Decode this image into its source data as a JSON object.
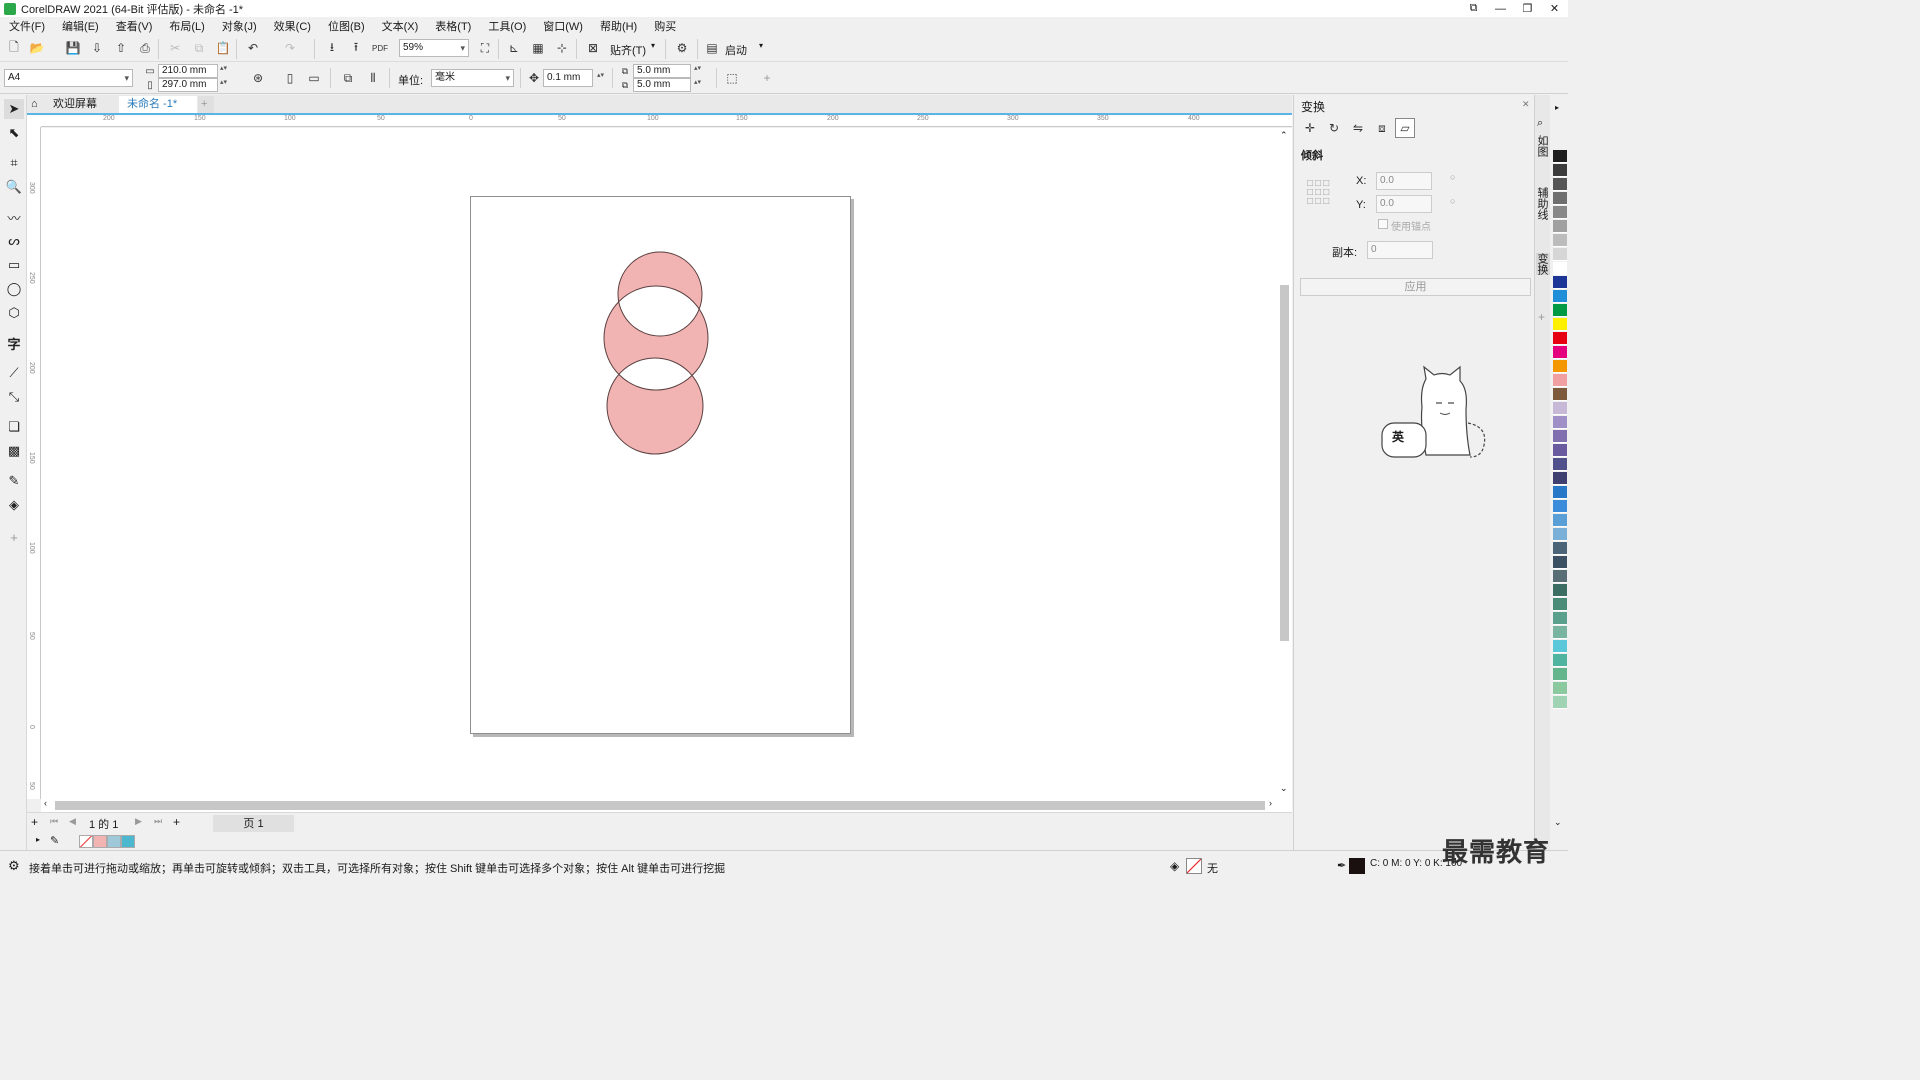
{
  "window": {
    "title": "CorelDRAW 2021 (64-Bit 评估版) - 未命名 -1*"
  },
  "menu": [
    "文件(F)",
    "编辑(E)",
    "查看(V)",
    "布局(L)",
    "对象(J)",
    "效果(C)",
    "位图(B)",
    "文本(X)",
    "表格(T)",
    "工具(O)",
    "窗口(W)",
    "帮助(H)",
    "购买"
  ],
  "toolbar": {
    "zoom": "59%",
    "snap_label": "贴齐(T)",
    "launch_label": "启动",
    "pdf_label": "PDF"
  },
  "propertybar": {
    "page_size": "A4",
    "width": "210.0 mm",
    "height": "297.0 mm",
    "unit_label": "单位:",
    "unit_value": "毫米",
    "nudge": "0.1 mm",
    "dup_x": "5.0 mm",
    "dup_y": "5.0 mm"
  },
  "tabs": {
    "welcome": "欢迎屏幕",
    "document": "未命名 -1*"
  },
  "ruler_h_labels": [
    "200",
    "150",
    "100",
    "50",
    "0",
    "50",
    "100",
    "150",
    "200",
    "250",
    "300",
    "350",
    "400"
  ],
  "ruler_v_labels": [
    "300",
    "250",
    "200",
    "150",
    "100",
    "50",
    "0",
    "50"
  ],
  "docker": {
    "title": "变换",
    "section": "倾斜",
    "x_label": "X:",
    "x_value": "0.0",
    "y_label": "Y:",
    "y_value": "0.0",
    "anchor_label": "使用锚点",
    "copies_label": "副本:",
    "copies_value": "0",
    "apply_label": "应用",
    "mascot_text": "英"
  },
  "side_tabs": [
    "如图",
    "辅助线",
    "变换"
  ],
  "pagenav": {
    "page_info": "1 的 1",
    "page_tab": "页 1"
  },
  "status": {
    "hint": "接着单击可进行拖动或缩放；再单击可旋转或倾斜；双击工具，可选择所有对象；按住 Shift 键单击可选择多个对象；按住 Alt 键单击可进行挖掘",
    "fill": "无",
    "color_info": "C: 0 M: 0 Y: 0 K: 100"
  },
  "watermark": "最需教育",
  "colors": {
    "circle_fill": "#f2b3b3",
    "circle_stroke": "#5a4040",
    "accent": "#5ab4e6"
  },
  "palette_colors": [
    "#1e1e1e",
    "#3c3c3c",
    "#555555",
    "#6e6e6e",
    "#888888",
    "#a0a0a0",
    "#bcbcbc",
    "#d6d6d6",
    "#ffffff",
    "#1c3596",
    "#1f8fd8",
    "#009944",
    "#fff000",
    "#e60012",
    "#e4007f",
    "#f39800",
    "#f0a0a0",
    "#7d5a3c",
    "#c8b8d8",
    "#a090c8",
    "#8070b0",
    "#6a5aa0",
    "#50508c",
    "#404070",
    "#2878c8",
    "#3c8cdc",
    "#5a9fd6",
    "#7ab0d8",
    "#4b6478",
    "#3c5064",
    "#5a6e78",
    "#3c6e64",
    "#4b8c78",
    "#5aa08c",
    "#78b4a0",
    "#5ac8d8",
    "#50b4a0",
    "#64b48c",
    "#8cc8a0",
    "#a0d2b4"
  ]
}
